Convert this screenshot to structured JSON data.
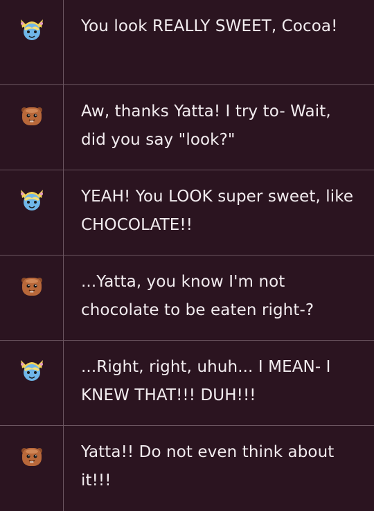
{
  "conversation": {
    "messages": [
      {
        "speaker_icon": "yatta-avatar-icon",
        "text": "You look REALLY SWEET, Cocoa!"
      },
      {
        "speaker_icon": "cocoa-avatar-icon",
        "text": "Aw, thanks Yatta! I try to- Wait, did you say \"look?\""
      },
      {
        "speaker_icon": "yatta-avatar-icon",
        "text": "YEAH! You LOOK super sweet, like CHOCOLATE!!"
      },
      {
        "speaker_icon": "cocoa-avatar-icon",
        "text": "...Yatta, you know I'm not chocolate to be eaten right-?"
      },
      {
        "speaker_icon": "yatta-avatar-icon",
        "text": "...Right, right, uhuh... I MEAN- I KNEW THAT!!! DUH!!!"
      },
      {
        "speaker_icon": "cocoa-avatar-icon",
        "text": "Yatta!! Do not even think about it!!!"
      }
    ]
  },
  "colors": {
    "background": "#2b1420",
    "grid_line": "#6b5560",
    "text": "#f2ecef",
    "yatta_blue": "#6fb6e8",
    "yatta_hair": "#f2d35a",
    "cocoa_brown": "#b8683a"
  }
}
